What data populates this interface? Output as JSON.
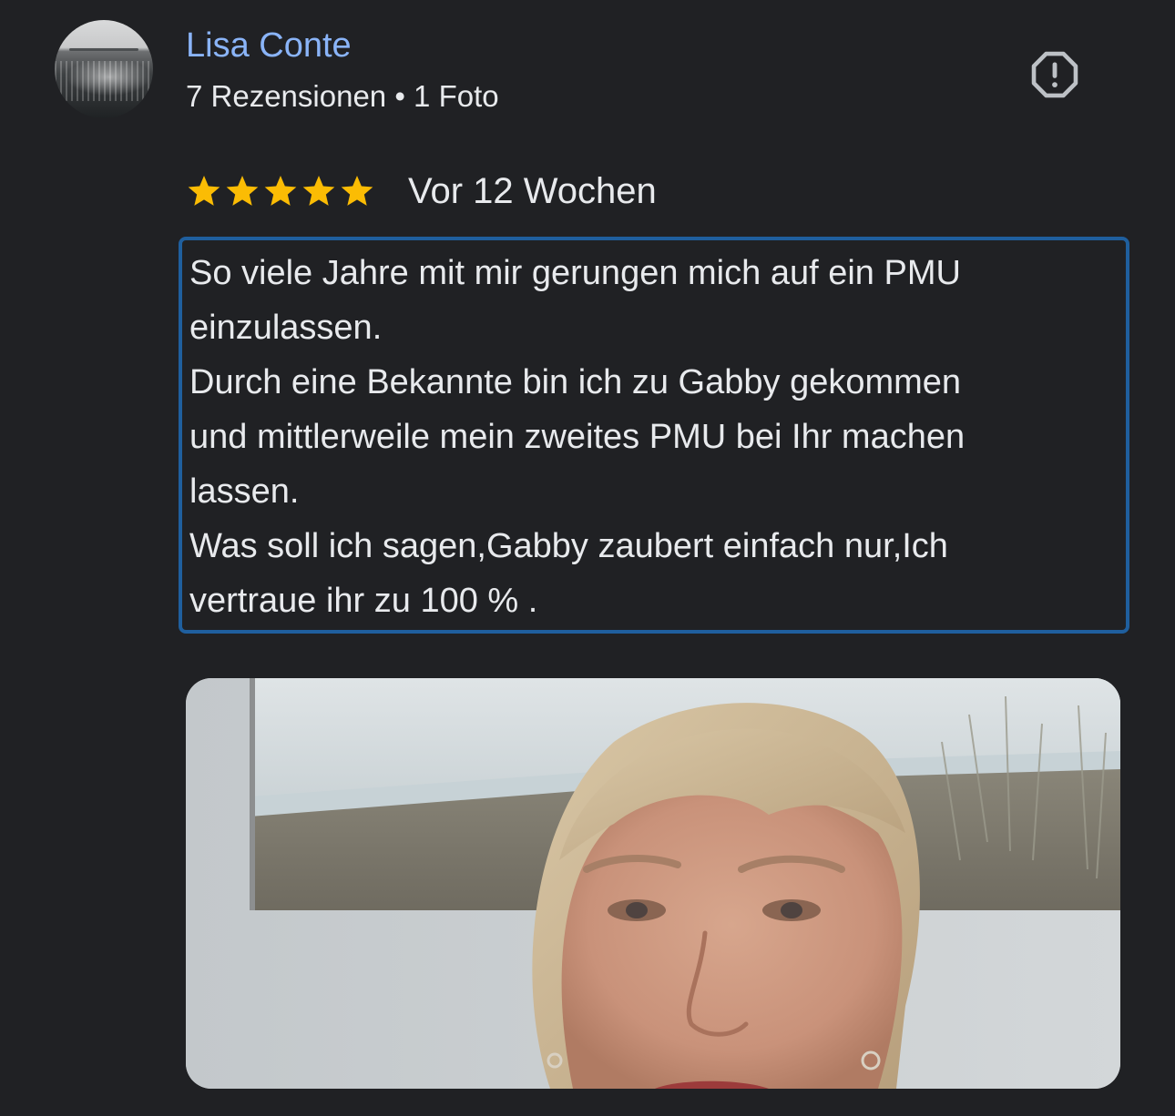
{
  "reviewer": {
    "name": "Lisa Conte",
    "meta": "7 Rezensionen • 1 Foto"
  },
  "review": {
    "rating": 5,
    "rating_max": 5,
    "date": "Vor 12 Wochen",
    "lines": [
      "So viele Jahre mit mir gerungen mich auf ein PMU",
      "einzulassen.",
      "Durch eine Bekannte bin ich zu Gabby gekommen",
      "und mittlerweile mein zweites PMU bei Ihr machen",
      "lassen.",
      "Was soll ich sagen,Gabby zaubert einfach nur,Ich",
      "vertraue ihr zu 100 % ."
    ]
  },
  "icons": {
    "report": "report-icon",
    "star": "star-icon"
  },
  "colors": {
    "background": "#202124",
    "name_link": "#8ab4f8",
    "star": "#fbbc04",
    "highlight_border": "#1f5f9e",
    "icon": "#bdc1c6"
  }
}
